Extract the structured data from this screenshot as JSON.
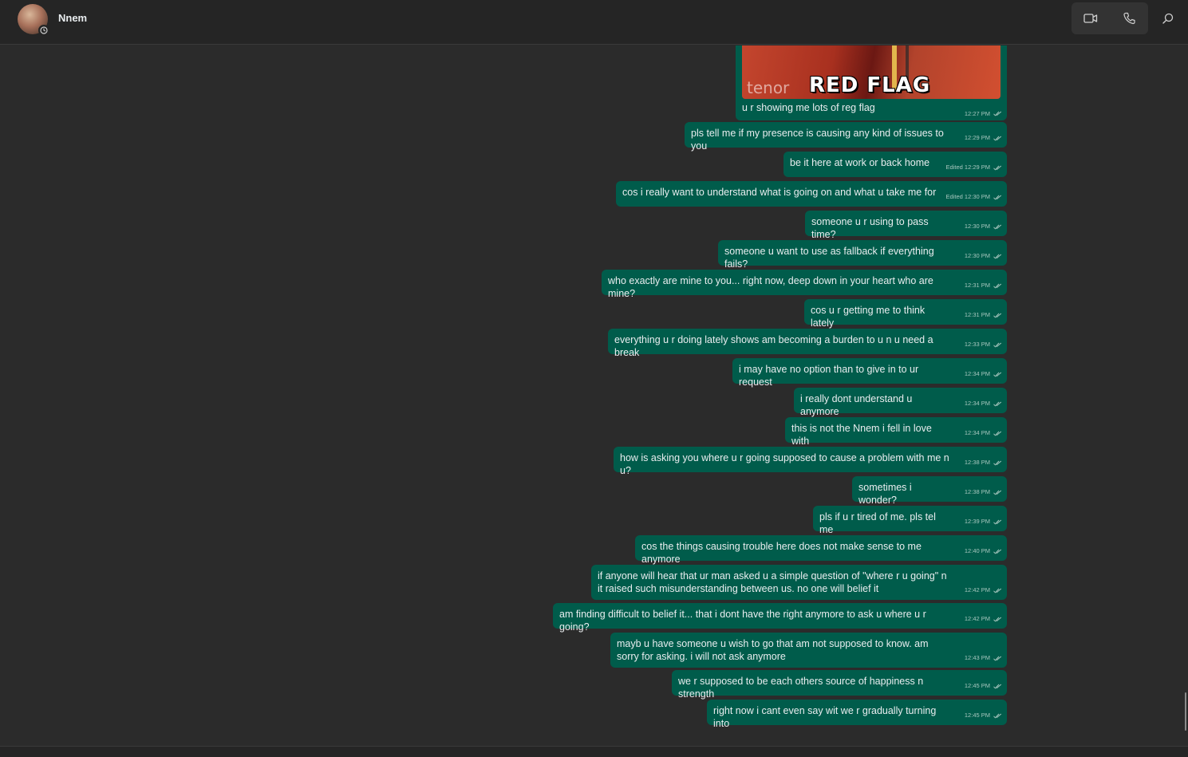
{
  "header": {
    "contact_name": "Nnem"
  },
  "gif_message": {
    "brand": "tenor",
    "overlay_text": "RED FLAG",
    "caption": "u r showing me lots of reg flag",
    "time": "12:27 PM"
  },
  "messages": [
    {
      "text": "pls tell me if my presence is causing any kind of issues to you",
      "time": "12:29 PM"
    },
    {
      "text": "be it here at work or back home",
      "time": "Edited 12:29 PM"
    },
    {
      "text": "cos i really want to understand what is going on and what u take me for",
      "time": "Edited 12:30 PM"
    },
    {
      "text": "someone u r using to pass time?",
      "time": "12:30 PM"
    },
    {
      "text": "someone u want to use as fallback if everything fails?",
      "time": "12:30 PM"
    },
    {
      "text": "who exactly are mine to you... right now, deep down in your heart who are mine?",
      "time": "12:31 PM"
    },
    {
      "text": "cos u r getting me to think lately",
      "time": "12:31 PM"
    },
    {
      "text": "everything u r doing lately shows am becoming a burden to u n u need a break",
      "time": "12:33 PM"
    },
    {
      "text": "i may have no option than to give in to ur request",
      "time": "12:34 PM"
    },
    {
      "text": "i really dont understand u anymore",
      "time": "12:34 PM"
    },
    {
      "text": "this is not the Nnem i fell in love with",
      "time": "12:34 PM"
    },
    {
      "text": "how is asking you where u r going supposed to cause a problem with me n u?",
      "time": "12:38 PM"
    },
    {
      "text": "sometimes i wonder?",
      "time": "12:38 PM"
    },
    {
      "text": "pls if u r tired of me. pls tel me",
      "time": "12:39 PM"
    },
    {
      "text": "cos the things causing trouble here does not make sense to me anymore",
      "time": "12:40 PM"
    },
    {
      "text": "if anyone will hear that ur man asked u a simple question of \"where r u going\" n it raised such misunderstanding between us. no one will belief it",
      "time": "12:42 PM"
    },
    {
      "text": "am finding difficult to belief it... that i dont have the right anymore to ask u where u r going?",
      "time": "12:42 PM"
    },
    {
      "text": "mayb u have someone u wish to go that am not supposed to know. am sorry for asking. i will not ask anymore",
      "time": "12:43 PM"
    },
    {
      "text": "we r supposed to be each others source of happiness n strength",
      "time": "12:45 PM"
    },
    {
      "text": "right now i cant even say wit we r gradually turning into",
      "time": "12:45 PM"
    }
  ]
}
